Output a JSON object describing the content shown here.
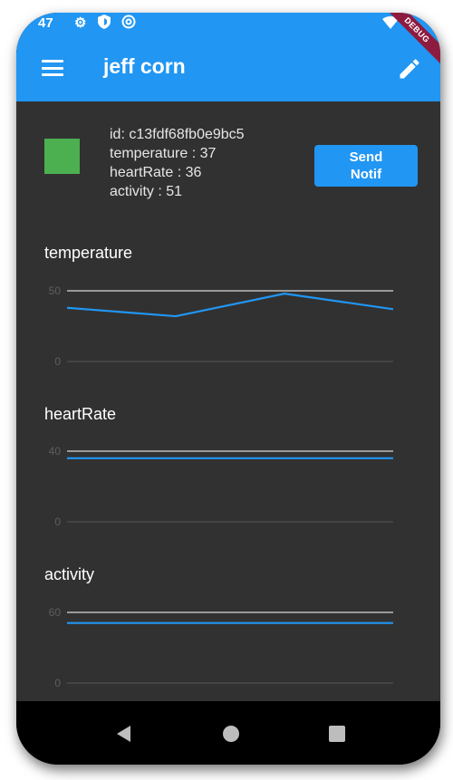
{
  "status_bar": {
    "time": "47",
    "icons": [
      "gear-icon",
      "shield-icon",
      "at-icon",
      "wifi-icon"
    ]
  },
  "app_bar": {
    "title": "jeff corn",
    "menu_icon": "menu-icon",
    "edit_icon": "edit-icon",
    "debug_banner": "DEBUG"
  },
  "device": {
    "color": "#4caf50",
    "id_line": "id: c13fdf68fb0e9bc5",
    "temperature_line": "temperature : 37",
    "heartrate_line": "heartRate : 36",
    "activity_line": "activity : 51"
  },
  "send_button": {
    "label_line1": "Send",
    "label_line2": "Notif"
  },
  "charts": [
    {
      "title": "temperature",
      "y_max_label": "50",
      "y_min_label": "0",
      "ylim": [
        0,
        50
      ],
      "line_color": "#2196f3",
      "values": [
        38,
        32,
        48,
        37
      ]
    },
    {
      "title": "heartRate",
      "y_max_label": "40",
      "y_min_label": "0",
      "ylim": [
        0,
        40
      ],
      "line_color": "#2196f3",
      "values": [
        36,
        36,
        36,
        36
      ]
    },
    {
      "title": "activity",
      "y_max_label": "60",
      "y_min_label": "0",
      "ylim": [
        0,
        60
      ],
      "line_color": "#2196f3",
      "values": [
        51,
        51,
        51,
        51
      ]
    }
  ],
  "nav_bar": {
    "icons": [
      "back-icon",
      "home-icon",
      "recent-apps-icon"
    ]
  }
}
